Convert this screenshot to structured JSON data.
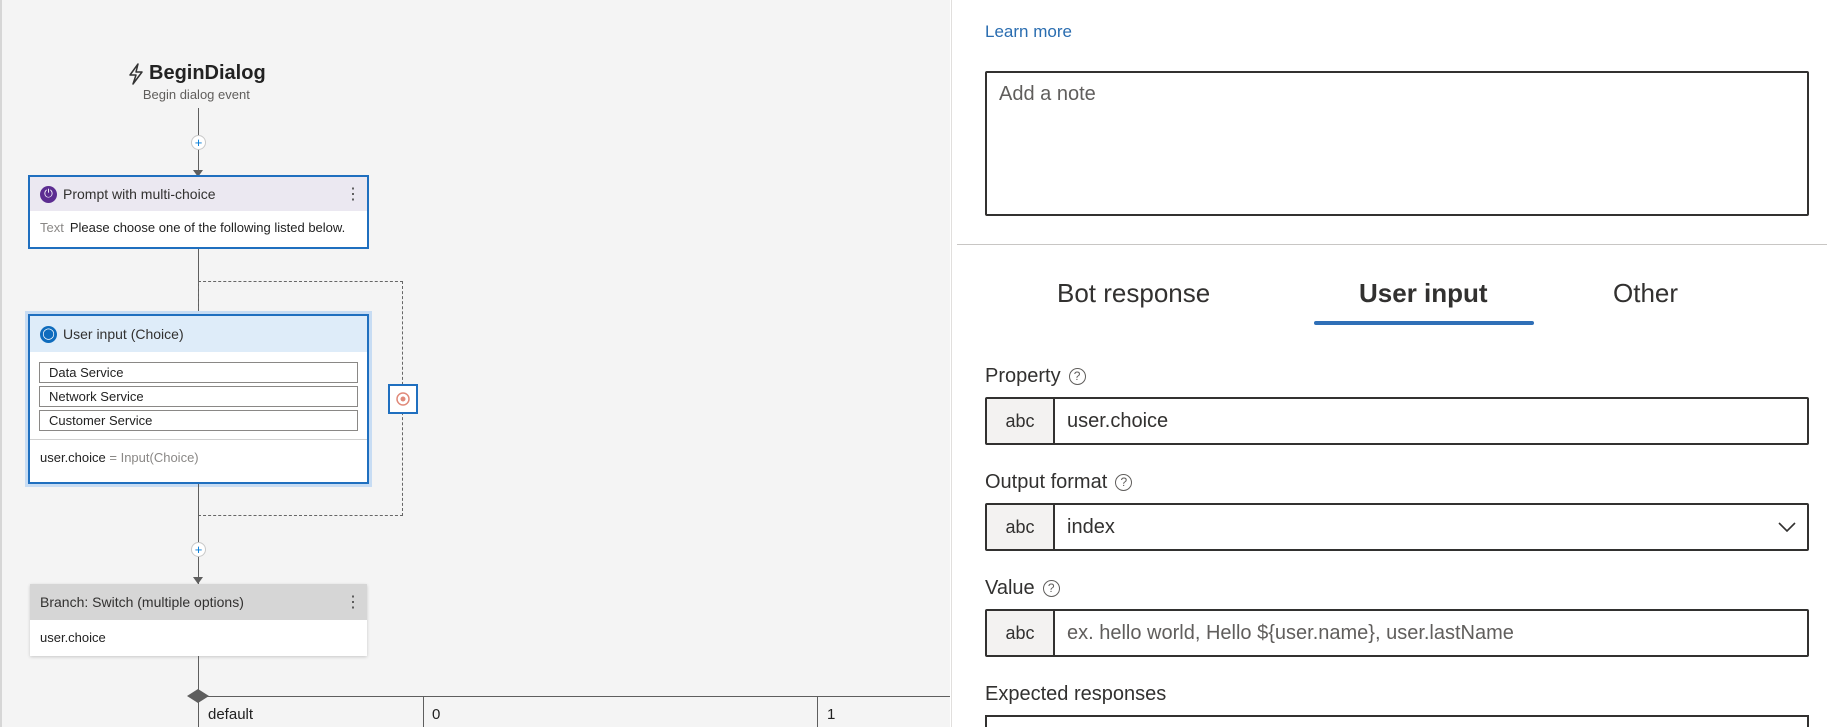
{
  "canvas": {
    "event": {
      "title": "BeginDialog",
      "subtitle": "Begin dialog event"
    },
    "prompt_node": {
      "title": "Prompt with multi-choice",
      "text_label": "Text",
      "text_value": "Please choose one of the following listed below.",
      "menu_icon": "more-vertical-icon"
    },
    "input_node": {
      "title": "User input (Choice)",
      "choices": [
        "Data Service",
        "Network Service",
        "Customer Service"
      ],
      "binding_property": "user.choice",
      "binding_expr": "= Input(Choice)"
    },
    "switch_node": {
      "title": "Branch: Switch (multiple options)",
      "condition": "user.choice",
      "menu_icon": "more-vertical-icon"
    },
    "branches": [
      "default",
      "0",
      "1"
    ]
  },
  "panel": {
    "learn_more": "Learn more",
    "note_placeholder": "Add a note",
    "tabs": [
      {
        "label": "Bot response",
        "active": false
      },
      {
        "label": "User input",
        "active": true
      },
      {
        "label": "Other",
        "active": false
      }
    ],
    "property": {
      "label": "Property",
      "prefix": "abc",
      "value": "user.choice"
    },
    "output_format": {
      "label": "Output format",
      "prefix": "abc",
      "value": "index"
    },
    "value": {
      "label": "Value",
      "prefix": "abc",
      "placeholder": "ex. hello world, Hello ${user.name}, user.lastName"
    },
    "expected_responses": {
      "label": "Expected responses"
    }
  },
  "colors": {
    "accent": "#1f6fbf",
    "prompt_icon": "#5c2d91",
    "input_icon": "#0f6cbd",
    "link": "#2a6db0"
  }
}
